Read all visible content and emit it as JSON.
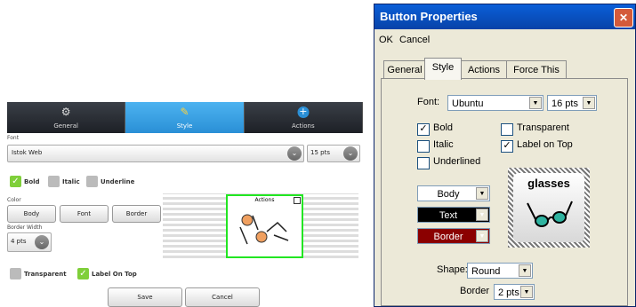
{
  "left": {
    "tabs": [
      {
        "label": "General"
      },
      {
        "label": "Style"
      },
      {
        "label": "Actions"
      }
    ],
    "font_label": "Font",
    "font_value": "Istok Web",
    "font_size": "15 pts",
    "bold_label": "Bold",
    "italic_label": "Italic",
    "underline_label": "Underline",
    "color_label": "Color",
    "body_btn": "Body",
    "font_btn": "Font",
    "border_btn": "Border",
    "border_width_label": "Border Width",
    "border_width_value": "4 pts",
    "preview_label": "Actions",
    "transparent_label": "Transparent",
    "label_on_top_label": "Label On Top",
    "save_btn": "Save",
    "cancel_btn": "Cancel"
  },
  "dialog": {
    "title": "Button Properties",
    "close": "✕",
    "menu": {
      "ok": "OK",
      "cancel": "Cancel"
    },
    "tabs": [
      {
        "label": "General"
      },
      {
        "label": "Style"
      },
      {
        "label": "Actions"
      },
      {
        "label": "Force This"
      }
    ],
    "font_label": "Font:",
    "font_value": "Ubuntu",
    "font_size": "16 pts",
    "bold_label": "Bold",
    "italic_label": "Italic",
    "underlined_label": "Underlined",
    "transparent_label": "Transparent",
    "label_on_top_label": "Label on Top",
    "body_sel": "Body",
    "text_sel": "Text",
    "border_sel": "Border",
    "preview_label": "glasses",
    "shape_label": "Shape:",
    "shape_value": "Round",
    "border_label": "Border",
    "border_value": "2 pts"
  }
}
